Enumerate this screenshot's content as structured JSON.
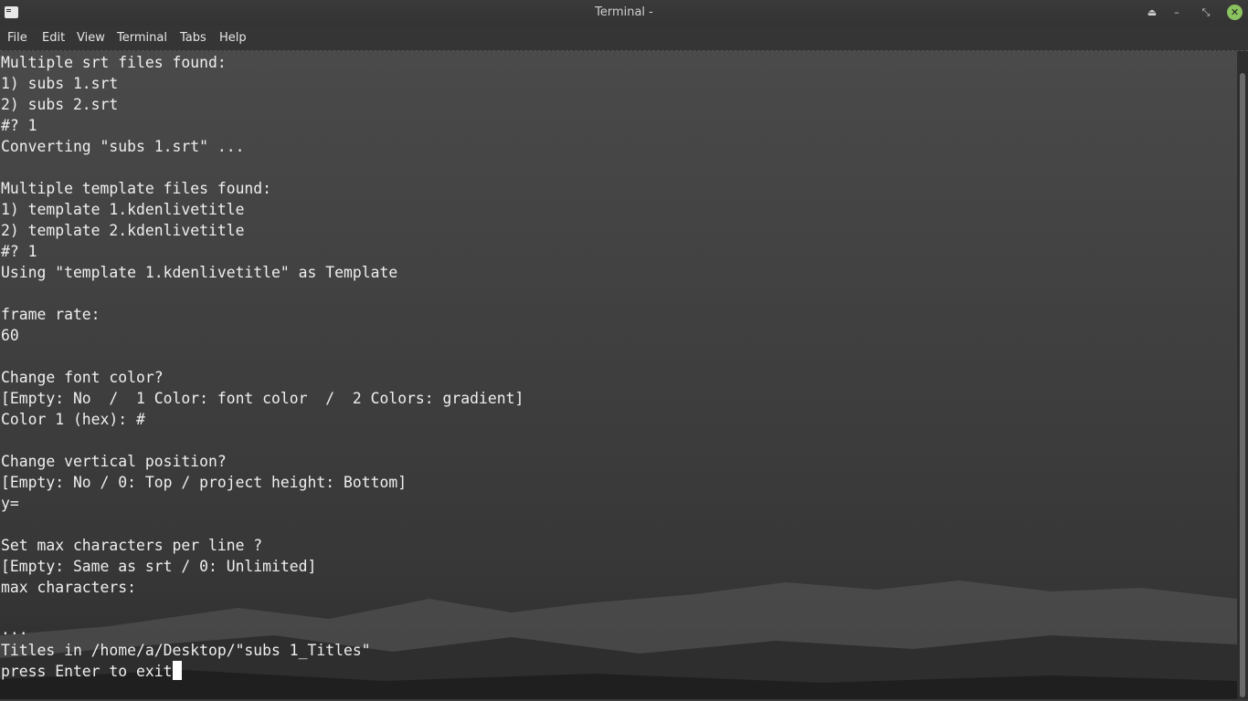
{
  "window": {
    "title": "Terminal -",
    "icon": "terminal-icon",
    "controls": {
      "eject": "⏏",
      "minimize": "–",
      "restore": "⤡",
      "close": "✕"
    }
  },
  "menu": [
    "File",
    "Edit",
    "View",
    "Terminal",
    "Tabs",
    "Help"
  ],
  "terminal": {
    "lines": [
      "Multiple srt files found:",
      "1) subs 1.srt",
      "2) subs 2.srt",
      "#? 1",
      "Converting \"subs 1.srt\" ...",
      "",
      "Multiple template files found:",
      "1) template 1.kdenlivetitle",
      "2) template 2.kdenlivetitle",
      "#? 1",
      "Using \"template 1.kdenlivetitle\" as Template",
      "",
      "frame rate:",
      "60",
      "",
      "Change font color?",
      "[Empty: No  /  1 Color: font color  /  2 Colors: gradient]",
      "Color 1 (hex): #",
      "",
      "Change vertical position?",
      "[Empty: No / 0: Top / project height: Bottom]",
      "y=",
      "",
      "Set max characters per line ?",
      "[Empty: Same as srt / 0: Unlimited]",
      "max characters:",
      "",
      "...",
      "Titles in /home/a/Desktop/\"subs 1_Titles\""
    ],
    "prompt_line": "press Enter to exit"
  },
  "colors": {
    "text": "#efefef",
    "close_button": "#8ac35f",
    "titlebar": "#353535"
  }
}
